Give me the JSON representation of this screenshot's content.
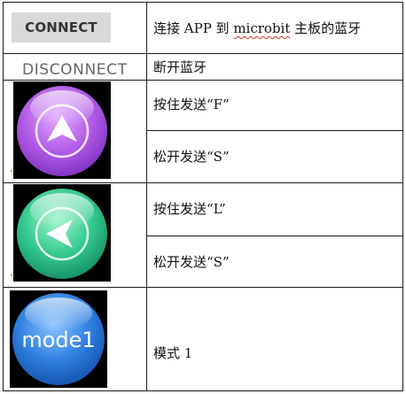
{
  "rows": [
    {
      "button": "CONNECT",
      "desc_parts": [
        "连接 APP 到 ",
        "microbit",
        " 主板的蓝牙"
      ]
    },
    {
      "button": "DISCONNECT",
      "desc": "断开蓝牙"
    },
    {
      "button_icon": "up-arrow-icon",
      "color": "#b85ee8",
      "desc_press": "按住发送“F”",
      "desc_release": "松开发送“S”"
    },
    {
      "button_icon": "left-arrow-icon",
      "color": "#2fbf8a",
      "desc_press": "按住发送“L”",
      "desc_release": "松开发送“S”"
    },
    {
      "button_label": "mode1",
      "color": "#2f7fe0",
      "desc": "模式 1"
    }
  ]
}
